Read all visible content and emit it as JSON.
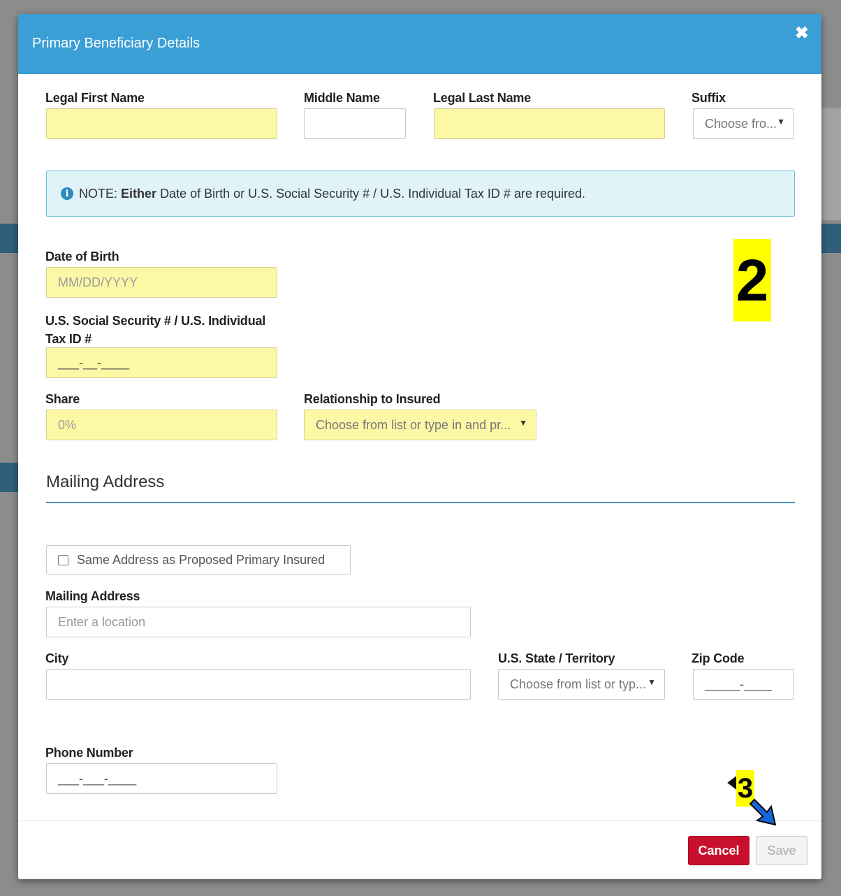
{
  "modal": {
    "title": "Primary Beneficiary Details",
    "close_glyph": "✖"
  },
  "names": {
    "first_label": "Legal First Name",
    "middle_label": "Middle Name",
    "last_label": "Legal Last Name",
    "suffix_label": "Suffix",
    "suffix_value": "Choose fro..."
  },
  "note": {
    "prefix": "NOTE:",
    "bold": "Either",
    "text": "Date of Birth or U.S. Social Security # / U.S. Individual Tax ID # are required."
  },
  "dob": {
    "label": "Date of Birth",
    "placeholder": "MM/DD/YYYY"
  },
  "ssn": {
    "label_line1": "U.S. Social Security # / U.S. Individual",
    "label_line2": "Tax ID #",
    "mask": "___-__-____"
  },
  "share": {
    "label": "Share",
    "placeholder": "0%"
  },
  "relationship": {
    "label": "Relationship to Insured",
    "value": "Choose from list or type in and pr..."
  },
  "mailing": {
    "section_title": "Mailing Address",
    "same_address_label": "Same Address as Proposed Primary Insured",
    "address_label": "Mailing Address",
    "address_placeholder": "Enter a location",
    "city_label": "City",
    "state_label": "U.S. State / Territory",
    "state_value": "Choose from list or typ...",
    "zip_label": "Zip Code",
    "zip_mask": "_____-____",
    "phone_label": "Phone Number",
    "phone_mask": "___-___-____"
  },
  "footer": {
    "cancel_label": "Cancel",
    "save_label": "Save"
  },
  "annotations": {
    "step2": "2",
    "step3": "3"
  },
  "colors": {
    "header": "#3a9fd4",
    "required_field": "#fdf8a6",
    "note_bg": "#e0f3f9",
    "cancel": "#c8102e"
  },
  "icons": {
    "info": "info-circle-icon",
    "close": "close-icon",
    "caret": "caret-down-icon",
    "arrow": "arrow-down-right-icon"
  }
}
